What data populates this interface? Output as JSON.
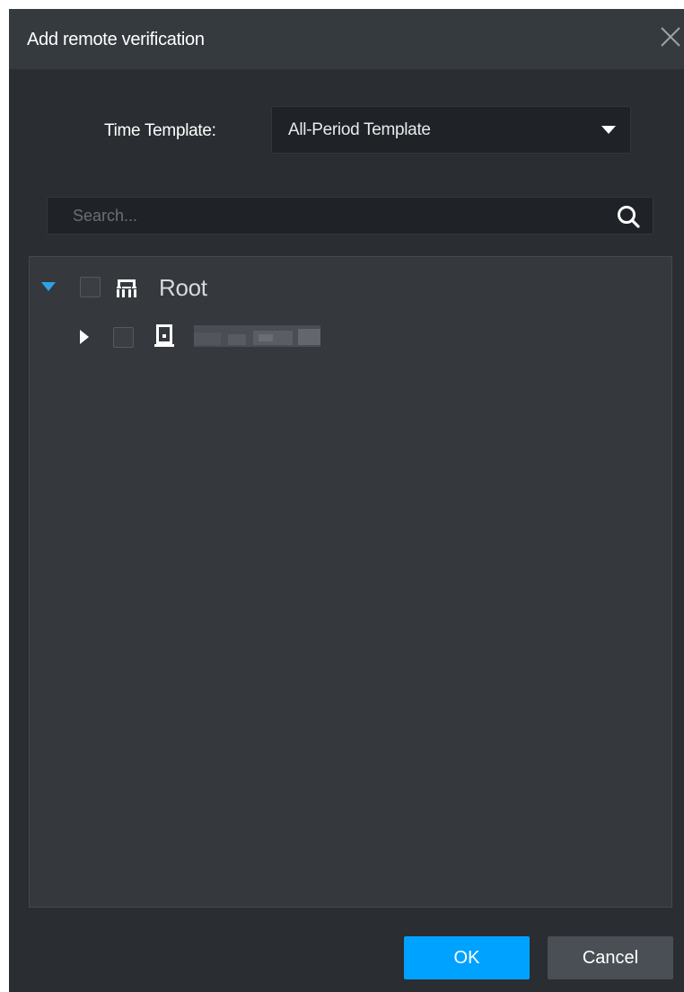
{
  "dialog": {
    "title": "Add remote verification",
    "close_icon": "close-icon"
  },
  "time_template": {
    "label": "Time Template:",
    "selected": "All-Period Template"
  },
  "search": {
    "placeholder": "Search...",
    "icon": "search-icon"
  },
  "tree": {
    "root": {
      "label": "Root",
      "expanded": true,
      "checked": false,
      "icon": "organization-icon"
    },
    "children": [
      {
        "label": "",
        "expanded": false,
        "checked": false,
        "icon": "door-device-icon",
        "redacted": true
      }
    ]
  },
  "footer": {
    "ok_label": "OK",
    "cancel_label": "Cancel"
  },
  "colors": {
    "dialog_bg": "#2a2d31",
    "titlebar_bg": "#353a3f",
    "panel_bg": "#35383d",
    "accent": "#00a2ff",
    "expander_accent": "#2ea2e5"
  }
}
